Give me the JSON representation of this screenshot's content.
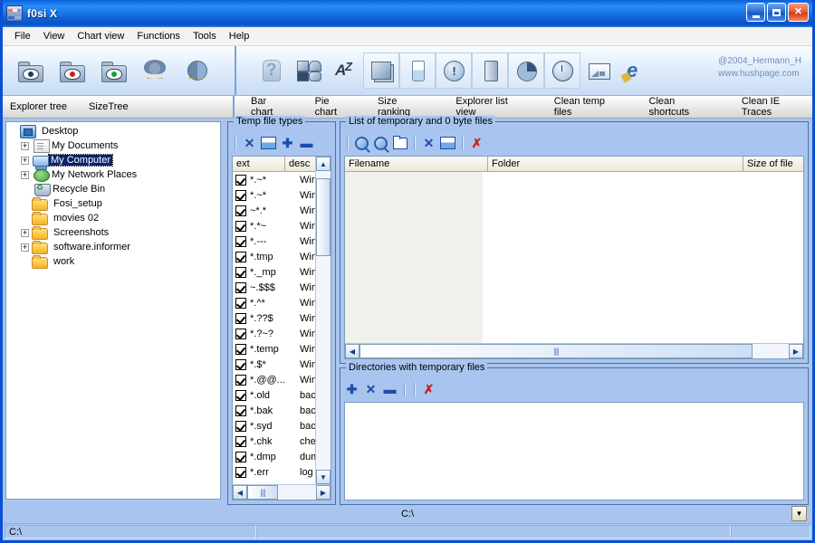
{
  "window": {
    "title": "f0si X",
    "icon": "app-icon",
    "buttons": {
      "minimize": "_",
      "maximize": "□",
      "close": "✕"
    }
  },
  "menu": [
    "File",
    "View",
    "Chart view",
    "Functions",
    "Tools",
    "Help"
  ],
  "toolbar_left": [
    {
      "name": "explorer-tree-gray-icon",
      "icon": "folder-eye-gray"
    },
    {
      "name": "explorer-tree-red-icon",
      "icon": "folder-eye-red"
    },
    {
      "name": "explorer-tree-green-icon",
      "icon": "folder-eye-green"
    },
    {
      "name": "sizetree-icon",
      "icon": "tree-expand"
    },
    {
      "name": "pie-expand-icon",
      "icon": "pie-expand"
    }
  ],
  "toolbar_left_labels": [
    "Explorer tree",
    "SizeTree"
  ],
  "toolbar_right": [
    {
      "name": "bar-chart-icon",
      "icon": "question-chart",
      "framed": false
    },
    {
      "name": "pie-chart-icon",
      "icon": "shapes",
      "framed": false
    },
    {
      "name": "sort-az-icon",
      "icon": "az",
      "framed": false
    },
    {
      "name": "size-ranking-icon",
      "icon": "stack",
      "framed": true
    },
    {
      "name": "explorer-list-view-icon",
      "icon": "glass",
      "framed": true
    },
    {
      "name": "clean-temp-files-icon",
      "icon": "bang",
      "framed": true
    },
    {
      "name": "clean-shortcuts-icon",
      "icon": "bin",
      "framed": true
    },
    {
      "name": "pie-ranking-icon",
      "icon": "pie2",
      "framed": true
    },
    {
      "name": "clock-icon",
      "icon": "clock",
      "framed": true
    },
    {
      "name": "chart-icon",
      "icon": "chart",
      "framed": false
    },
    {
      "name": "clean-ie-traces-icon",
      "icon": "ie-broom",
      "framed": false
    }
  ],
  "toolbar_right_labels": [
    "Bar chart",
    "Pie chart",
    "Size ranking",
    "Explorer list view",
    "Clean temp files",
    "Clean shortcuts",
    "Clean IE Traces"
  ],
  "copyright": {
    "line1": "@2004_Hermann_H",
    "line2": "www.hushpage.com"
  },
  "tree": {
    "nodes": [
      {
        "label": "Desktop",
        "icon": "desktop-icon",
        "expander": "",
        "indent": 0,
        "selected": false
      },
      {
        "label": "My Documents",
        "icon": "documents-icon",
        "expander": "+",
        "indent": 1,
        "selected": false
      },
      {
        "label": "My Computer",
        "icon": "computer-icon",
        "expander": "+",
        "indent": 1,
        "selected": true
      },
      {
        "label": "My Network Places",
        "icon": "network-icon",
        "expander": "+",
        "indent": 1,
        "selected": false
      },
      {
        "label": "Recycle Bin",
        "icon": "recycle-bin-icon",
        "expander": "",
        "indent": 1,
        "selected": false
      },
      {
        "label": "Fosi_setup",
        "icon": "folder-icon",
        "expander": "",
        "indent": 1,
        "selected": false
      },
      {
        "label": "movies 02",
        "icon": "folder-icon",
        "expander": "",
        "indent": 1,
        "selected": false
      },
      {
        "label": "Screenshots",
        "icon": "folder-icon",
        "expander": "+",
        "indent": 1,
        "selected": false
      },
      {
        "label": "software.informer",
        "icon": "folder-icon",
        "expander": "+",
        "indent": 1,
        "selected": false
      },
      {
        "label": "work",
        "icon": "folder-icon",
        "expander": "",
        "indent": 1,
        "selected": false
      }
    ]
  },
  "temp_types": {
    "legend": "Temp file types",
    "toolbar": [
      {
        "name": "uncheck-all-button",
        "icon": "blue-x"
      },
      {
        "name": "check-all-button",
        "icon": "blue-box"
      },
      {
        "name": "add-type-button",
        "icon": "plus"
      },
      {
        "name": "remove-type-button",
        "icon": "minus"
      }
    ],
    "columns": [
      "ext",
      "desc"
    ],
    "rows": [
      {
        "checked": true,
        "ext": "*.~*",
        "desc": "Wind"
      },
      {
        "checked": true,
        "ext": "*.~*",
        "desc": "Wind"
      },
      {
        "checked": true,
        "ext": "~*.*",
        "desc": "Wind"
      },
      {
        "checked": true,
        "ext": "*.*~",
        "desc": "Wind"
      },
      {
        "checked": true,
        "ext": "*.---",
        "desc": "Wind"
      },
      {
        "checked": true,
        "ext": "*.tmp",
        "desc": "Wind"
      },
      {
        "checked": true,
        "ext": "*._mp",
        "desc": "Wind"
      },
      {
        "checked": true,
        "ext": "~.$$$",
        "desc": "Wind"
      },
      {
        "checked": true,
        "ext": "*.^*",
        "desc": "Wind"
      },
      {
        "checked": true,
        "ext": "*.??$",
        "desc": "Wind"
      },
      {
        "checked": true,
        "ext": "*.?~?",
        "desc": "Wind"
      },
      {
        "checked": true,
        "ext": "*.temp",
        "desc": "Wind"
      },
      {
        "checked": true,
        "ext": "*.$*",
        "desc": "Wind"
      },
      {
        "checked": true,
        "ext": "*.@@...",
        "desc": "Wind"
      },
      {
        "checked": true,
        "ext": "*.old",
        "desc": "back"
      },
      {
        "checked": true,
        "ext": "*.bak",
        "desc": "back"
      },
      {
        "checked": true,
        "ext": "*.syd",
        "desc": "back"
      },
      {
        "checked": true,
        "ext": "*.chk",
        "desc": "chec"
      },
      {
        "checked": true,
        "ext": "*.dmp",
        "desc": "dump"
      },
      {
        "checked": true,
        "ext": "*.err",
        "desc": "log fi"
      }
    ]
  },
  "file_list": {
    "legend": "List of temporary and 0 byte files",
    "toolbar": [
      {
        "name": "search-button",
        "icon": "magnifier"
      },
      {
        "name": "search-subfolders-button",
        "icon": "magnifier"
      },
      {
        "name": "open-folder-button",
        "icon": "folder-outline"
      },
      {
        "name": "uncheck-all-files-button",
        "icon": "blue-x"
      },
      {
        "name": "check-all-files-button",
        "icon": "blue-box"
      },
      {
        "name": "delete-files-button",
        "icon": "red-x"
      }
    ],
    "columns": [
      "Filename",
      "Folder",
      "Size of file"
    ],
    "rows": []
  },
  "directories": {
    "legend": "Directories with temporary files",
    "toolbar": [
      {
        "name": "add-directory-button",
        "icon": "plus"
      },
      {
        "name": "uncheck-all-dirs-button",
        "icon": "blue-x"
      },
      {
        "name": "remove-directory-button",
        "icon": "minus"
      },
      {
        "name": "delete-directories-button",
        "icon": "red-x"
      }
    ],
    "rows": []
  },
  "path_bar": {
    "value": "C:\\",
    "dropdown": "▼"
  },
  "status_bar": {
    "pane1": "C:\\",
    "pane2": "",
    "pane3": ""
  }
}
